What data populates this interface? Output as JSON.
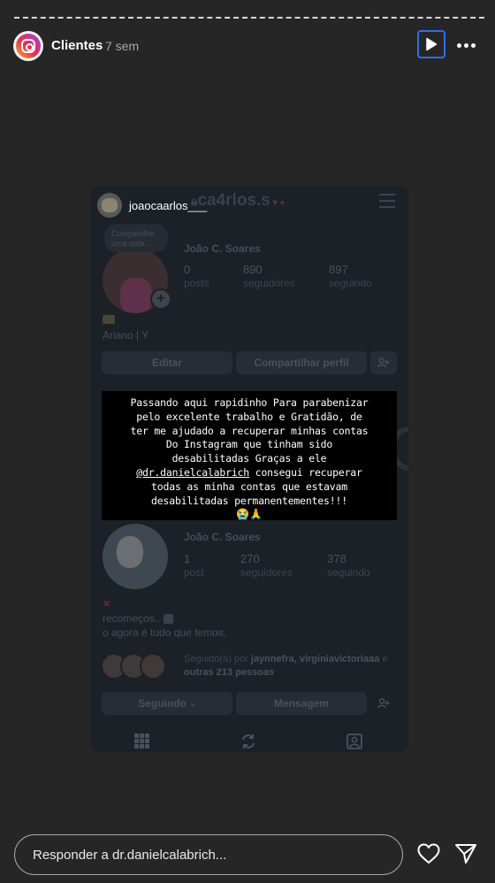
{
  "story": {
    "progress": 1.0,
    "account_name": "Clientes",
    "time_ago": "7 sem",
    "play_icon": "play-icon",
    "more_icon": "more-icon"
  },
  "card": {
    "top_username": "joaocaarlos___",
    "account_handle": "ca4rlos.s",
    "bubble_text": "Compartilhe uma nota...",
    "profile1": {
      "name": "João C. Soares",
      "posts": "0",
      "posts_label": "posts",
      "followers": "890",
      "followers_label": "seguidores",
      "following": "897",
      "following_label": "seguindo",
      "bio_line": "Ariano | Y",
      "edit_label": "Editar",
      "share_label": "Compartilhar perfil"
    },
    "caption": {
      "line1": "Passando aqui rapidinho Para parabenizar",
      "line2": "pelo excelente trabalho e Gratidão, de",
      "line3": "ter me ajudado a recuperar minhas contas",
      "line4": "Do Instagram que tinham sido",
      "line5": "desabilitadas Graças a ele",
      "mention": "@dr.danielcalabrich",
      "line6_rest": " consegui recuperar",
      "line7": "todas as minha contas que estavam",
      "line8": "desabilitadas permanentementes!!!",
      "emojis": "😭🙏"
    },
    "profile2": {
      "name": "João C. Soares",
      "posts": "1",
      "posts_label": "post",
      "followers": "270",
      "followers_label": "seguidores",
      "following": "378",
      "following_label": "seguindo",
      "bio_line1": "recomeços..",
      "bio_line2": "o agora é tudo que temos.",
      "followed_by_prefix": "Seguido(a) por ",
      "followed_by_names": "jaynnefra, virginiavictoriaaa",
      "followed_by_suffix": " e",
      "followed_by_others": "outras 213 pessoas",
      "following_btn": "Seguindo",
      "message_btn": "Mensagem"
    }
  },
  "reply": {
    "placeholder": "Responder a dr.danielcalabrich..."
  },
  "colors": {
    "background": "#262626",
    "accent": "#2f6fe6",
    "card": "#1b2127"
  }
}
